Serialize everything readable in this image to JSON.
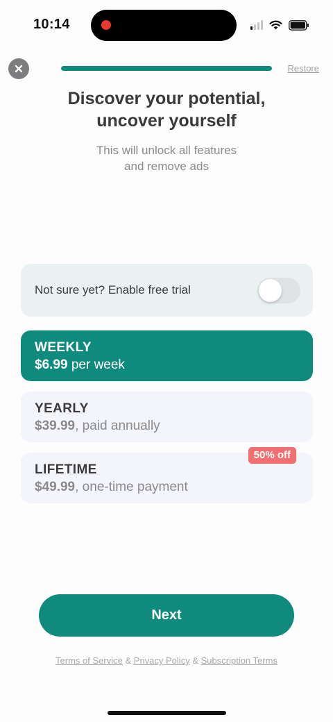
{
  "status": {
    "time": "10:14",
    "signal_bars_active": 1,
    "icons": [
      "signal-icon",
      "wifi-icon",
      "battery-icon"
    ]
  },
  "header": {
    "close_icon": "close-icon",
    "progress_fraction": 1.0,
    "restore_label": "Restore"
  },
  "hero": {
    "title_line1": "Discover your potential,",
    "title_line2": "uncover yourself",
    "subtitle_line1": "This will unlock all features",
    "subtitle_line2": "and remove ads"
  },
  "trial": {
    "label": "Not sure yet? Enable free trial",
    "enabled": false
  },
  "plans": [
    {
      "name": "WEEKLY",
      "price": "$6.99",
      "detail": " per week",
      "selected": true,
      "badge": ""
    },
    {
      "name": "YEARLY",
      "price": "$39.99",
      "detail": ", paid annually",
      "selected": false,
      "badge": ""
    },
    {
      "name": "LIFETIME",
      "price": "$49.99",
      "detail": ", one-time payment",
      "selected": false,
      "badge": "50% off"
    }
  ],
  "cta": {
    "label": "Next"
  },
  "legal": {
    "terms": "Terms of Service",
    "sep1": "&",
    "privacy": "Privacy Policy",
    "sep2": "&",
    "subscription": "Subscription Terms"
  },
  "colors": {
    "accent": "#0e8b7d",
    "badge": "#f16f6f",
    "card_bg": "#f3f5fa",
    "trial_bg": "#ebf1f3"
  }
}
